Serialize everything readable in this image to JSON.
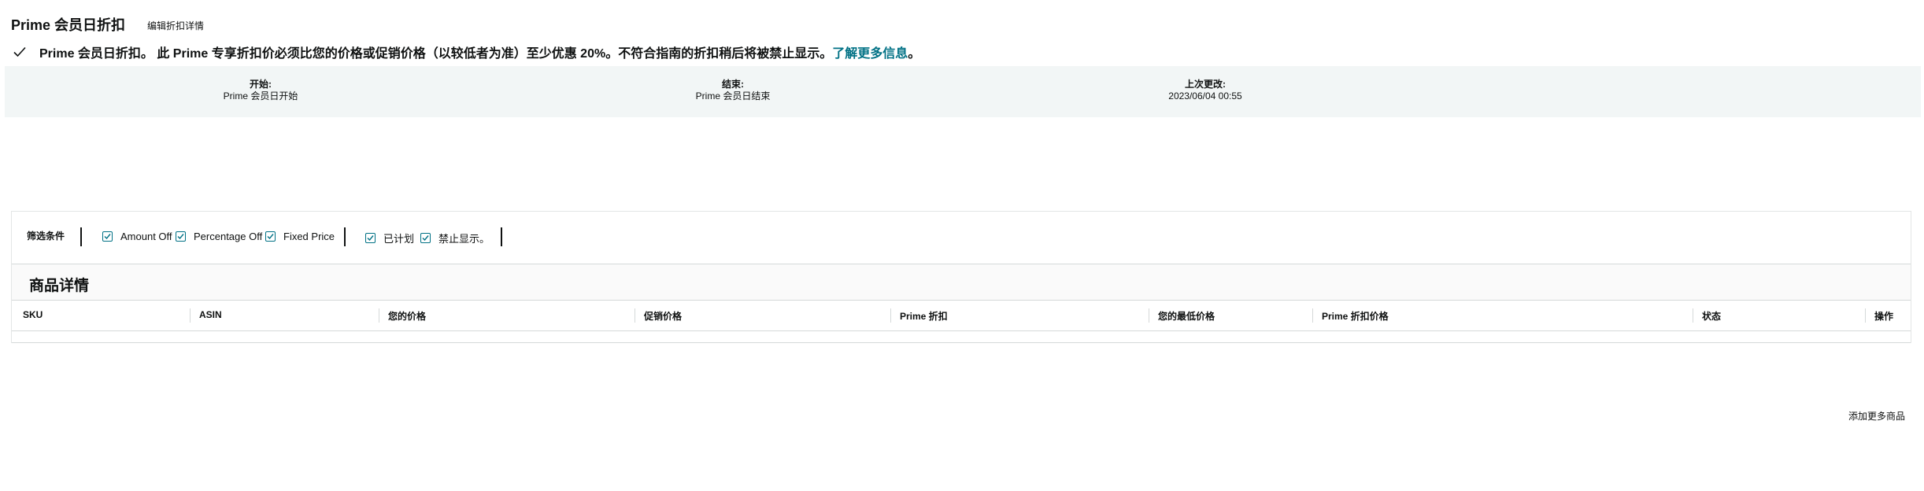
{
  "header": {
    "title": "Prime 会员日折扣",
    "edit_link": "编辑折扣详情"
  },
  "notice": {
    "text": "Prime 会员日折扣。 此 Prime 专享折扣价必须比您的价格或促销价格（以较低者为准）至少优惠 20%。不符合指南的折扣稍后将被禁止显示。",
    "link": "了解更多信息",
    "suffix": "。"
  },
  "dates": {
    "start": {
      "label": "开始:",
      "value": "Prime 会员日开始"
    },
    "end": {
      "label": "结束:",
      "value": "Prime 会员日结束"
    },
    "updated": {
      "label": "上次更改:",
      "value": "2023/06/04 00:55"
    }
  },
  "filters": {
    "label": "筛选条件",
    "type_options": [
      {
        "label": "Amount Off",
        "checked": true
      },
      {
        "label": "Percentage Off",
        "checked": true
      },
      {
        "label": "Fixed Price",
        "checked": true
      }
    ],
    "status_options": [
      {
        "label": "已计划",
        "checked": true
      },
      {
        "label": "禁止显示。",
        "checked": true
      }
    ]
  },
  "products": {
    "title": "商品详情",
    "columns": [
      "SKU",
      "ASIN",
      "您的价格",
      "促销价格",
      "Prime 折扣",
      "您的最低价格",
      "Prime 折扣价格",
      "状态",
      "操作"
    ],
    "rows": []
  },
  "footer": {
    "add_more": "添加更多商品"
  },
  "colors": {
    "accent": "#007185",
    "panel_bg": "#f2f6f6",
    "border": "#d5d9d9"
  }
}
